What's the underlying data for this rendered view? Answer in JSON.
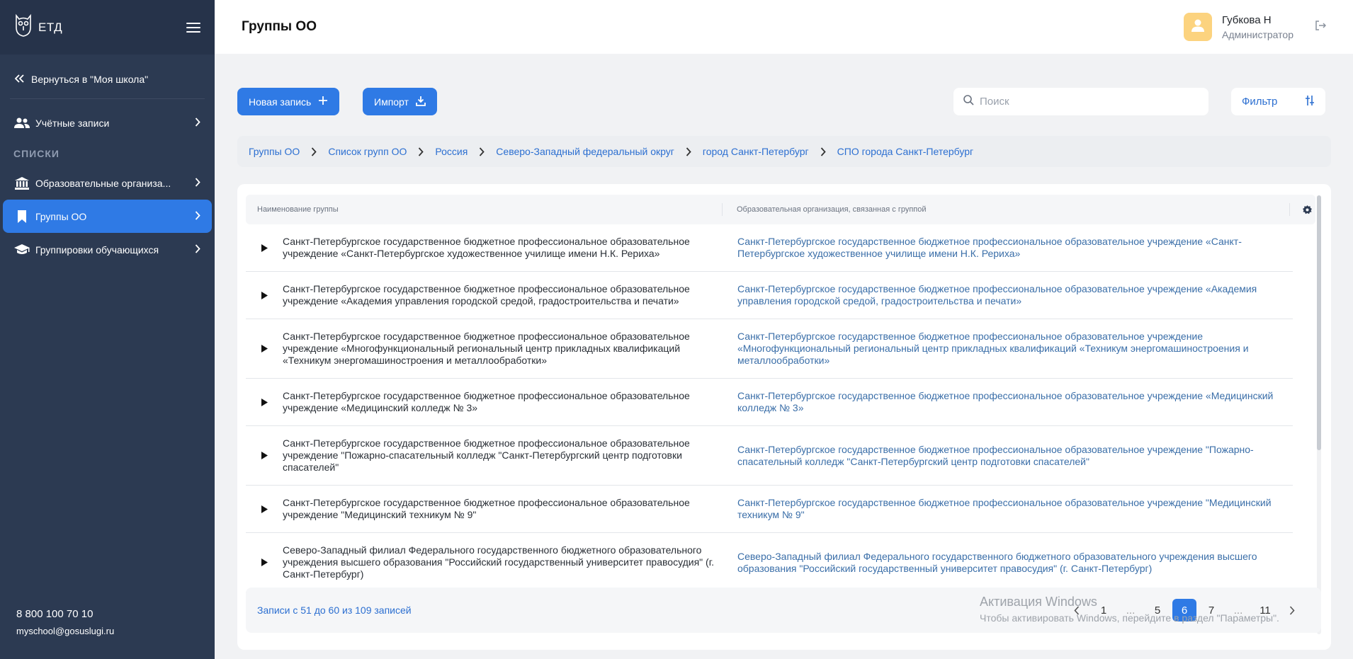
{
  "app": {
    "logo_text": "ЕТД"
  },
  "sidebar": {
    "back_label": "Вернуться в \"Моя школа\"",
    "item_accounts": "Учётные записи",
    "section_label": "СПИСКИ",
    "item_orgs": "Образовательные организа...",
    "item_groups": "Группы ОО",
    "item_student_groups": "Группировки обучающихся",
    "phone": "8 800 100 70 10",
    "email": "myschool@gosuslugi.ru"
  },
  "header": {
    "title": "Группы ОО",
    "user_name": "Губкова Н",
    "user_role": "Администратор"
  },
  "toolbar": {
    "new_label": "Новая запись",
    "import_label": "Импорт",
    "search_placeholder": "Поиск",
    "filter_label": "Фильтр"
  },
  "breadcrumbs": {
    "c0": "Группы ОО",
    "c1": "Список групп ОО",
    "c2": "Россия",
    "c3": "Северо-Западный федеральный округ",
    "c4": "город Санкт-Петербург",
    "c5": "СПО города Санкт-Петербург"
  },
  "table": {
    "col1": "Наименование группы",
    "col2": "Образовательная организация, связанная с группой",
    "rows": [
      {
        "name": "Санкт-Петербургское государственное бюджетное профессиональное образовательное учреждение «Санкт-Петербургское художественное училище имени Н.К. Рериха»",
        "org": "Санкт-Петербургское государственное бюджетное профессиональное образовательное учреждение «Санкт-Петербургское художественное училище имени Н.К. Рериха»"
      },
      {
        "name": "Санкт-Петербургское государственное бюджетное профессиональное образовательное учреждение «Академия управления городской средой, градостроительства и печати»",
        "org": "Санкт-Петербургское государственное бюджетное профессиональное образовательное учреждение «Академия управления городской средой, градостроительства и печати»"
      },
      {
        "name": "Санкт-Петербургское государственное бюджетное профессиональное образовательное учреждение «Многофункциональный региональный центр прикладных квалификаций «Техникум энергомашиностроения и металлообработки»",
        "org": "Санкт-Петербургское государственное бюджетное профессиональное образовательное учреждение «Многофункциональный региональный центр прикладных квалификаций «Техникум энергомашиностроения и металлообработки»"
      },
      {
        "name": "Санкт-Петербургское государственное бюджетное профессиональное образовательное учреждение «Медицинский колледж № 3»",
        "org": "Санкт-Петербургское государственное бюджетное профессиональное образовательное учреждение «Медицинский колледж № 3»"
      },
      {
        "name": "Санкт-Петербургское государственное бюджетное профессиональное образовательное учреждение \"Пожарно-спасательный колледж \"Санкт-Петербургский центр подготовки спасателей\"",
        "org": "Санкт-Петербургское государственное бюджетное профессиональное образовательное учреждение \"Пожарно-спасательный колледж \"Санкт-Петербургский центр подготовки спасателей\""
      },
      {
        "name": "Санкт-Петербургское государственное бюджетное профессиональное образовательное учреждение \"Медицинский техникум № 9\"",
        "org": "Санкт-Петербургское государственное бюджетное профессиональное образовательное учреждение \"Медицинский техникум № 9\""
      },
      {
        "name": "Северо-Западный филиал Федерального государственного бюджетного образовательного учреждения высшего образования \"Российский государственный университет правосудия\" (г. Санкт-Петербург)",
        "org": "Северо-Западный филиал Федерального государственного бюджетного образовательного учреждения высшего образования \"Российский государственный университет правосудия\" (г. Санкт-Петербург)"
      }
    ]
  },
  "pager": {
    "summary": "Записи с 51 до 60 из 109 записей",
    "p1": "1",
    "dots1": "...",
    "p5": "5",
    "p6": "6",
    "p7": "7",
    "dots2": "...",
    "p11": "11"
  },
  "overlay": {
    "line1": "Активация Windows",
    "line2": "Чтобы активировать Windows, перейдите в раздел \"Параметры\"."
  }
}
